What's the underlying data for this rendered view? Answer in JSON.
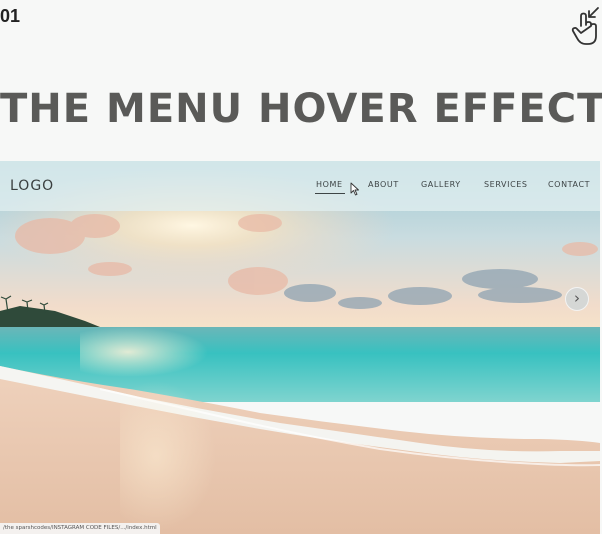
{
  "corner": {
    "number": "01"
  },
  "headline": {
    "text": "THE MENU HOVER EFFECT"
  },
  "website": {
    "logo": "LOGO",
    "nav": [
      {
        "label": "HOME",
        "active": true
      },
      {
        "label": "ABOUT"
      },
      {
        "label": "GALLERY"
      },
      {
        "label": "SERVICES"
      },
      {
        "label": "CONTACT"
      }
    ],
    "slider_next_icon": "chevron-right-icon",
    "slider_next_glyph": "›"
  },
  "status_bar": {
    "url": "/the sparshcodes/INSTAGRAM CODE FILES/.../index.html"
  },
  "colors": {
    "headline": "#5a5a58",
    "navbar_bg": "#e0eef0",
    "nav_text": "#3e4546",
    "sea": "#4fc4c2",
    "sand": "#e9c9b0"
  },
  "icons": {
    "corner_icon": "swipe-hand-icon",
    "pointer": "mouse-cursor-icon"
  }
}
